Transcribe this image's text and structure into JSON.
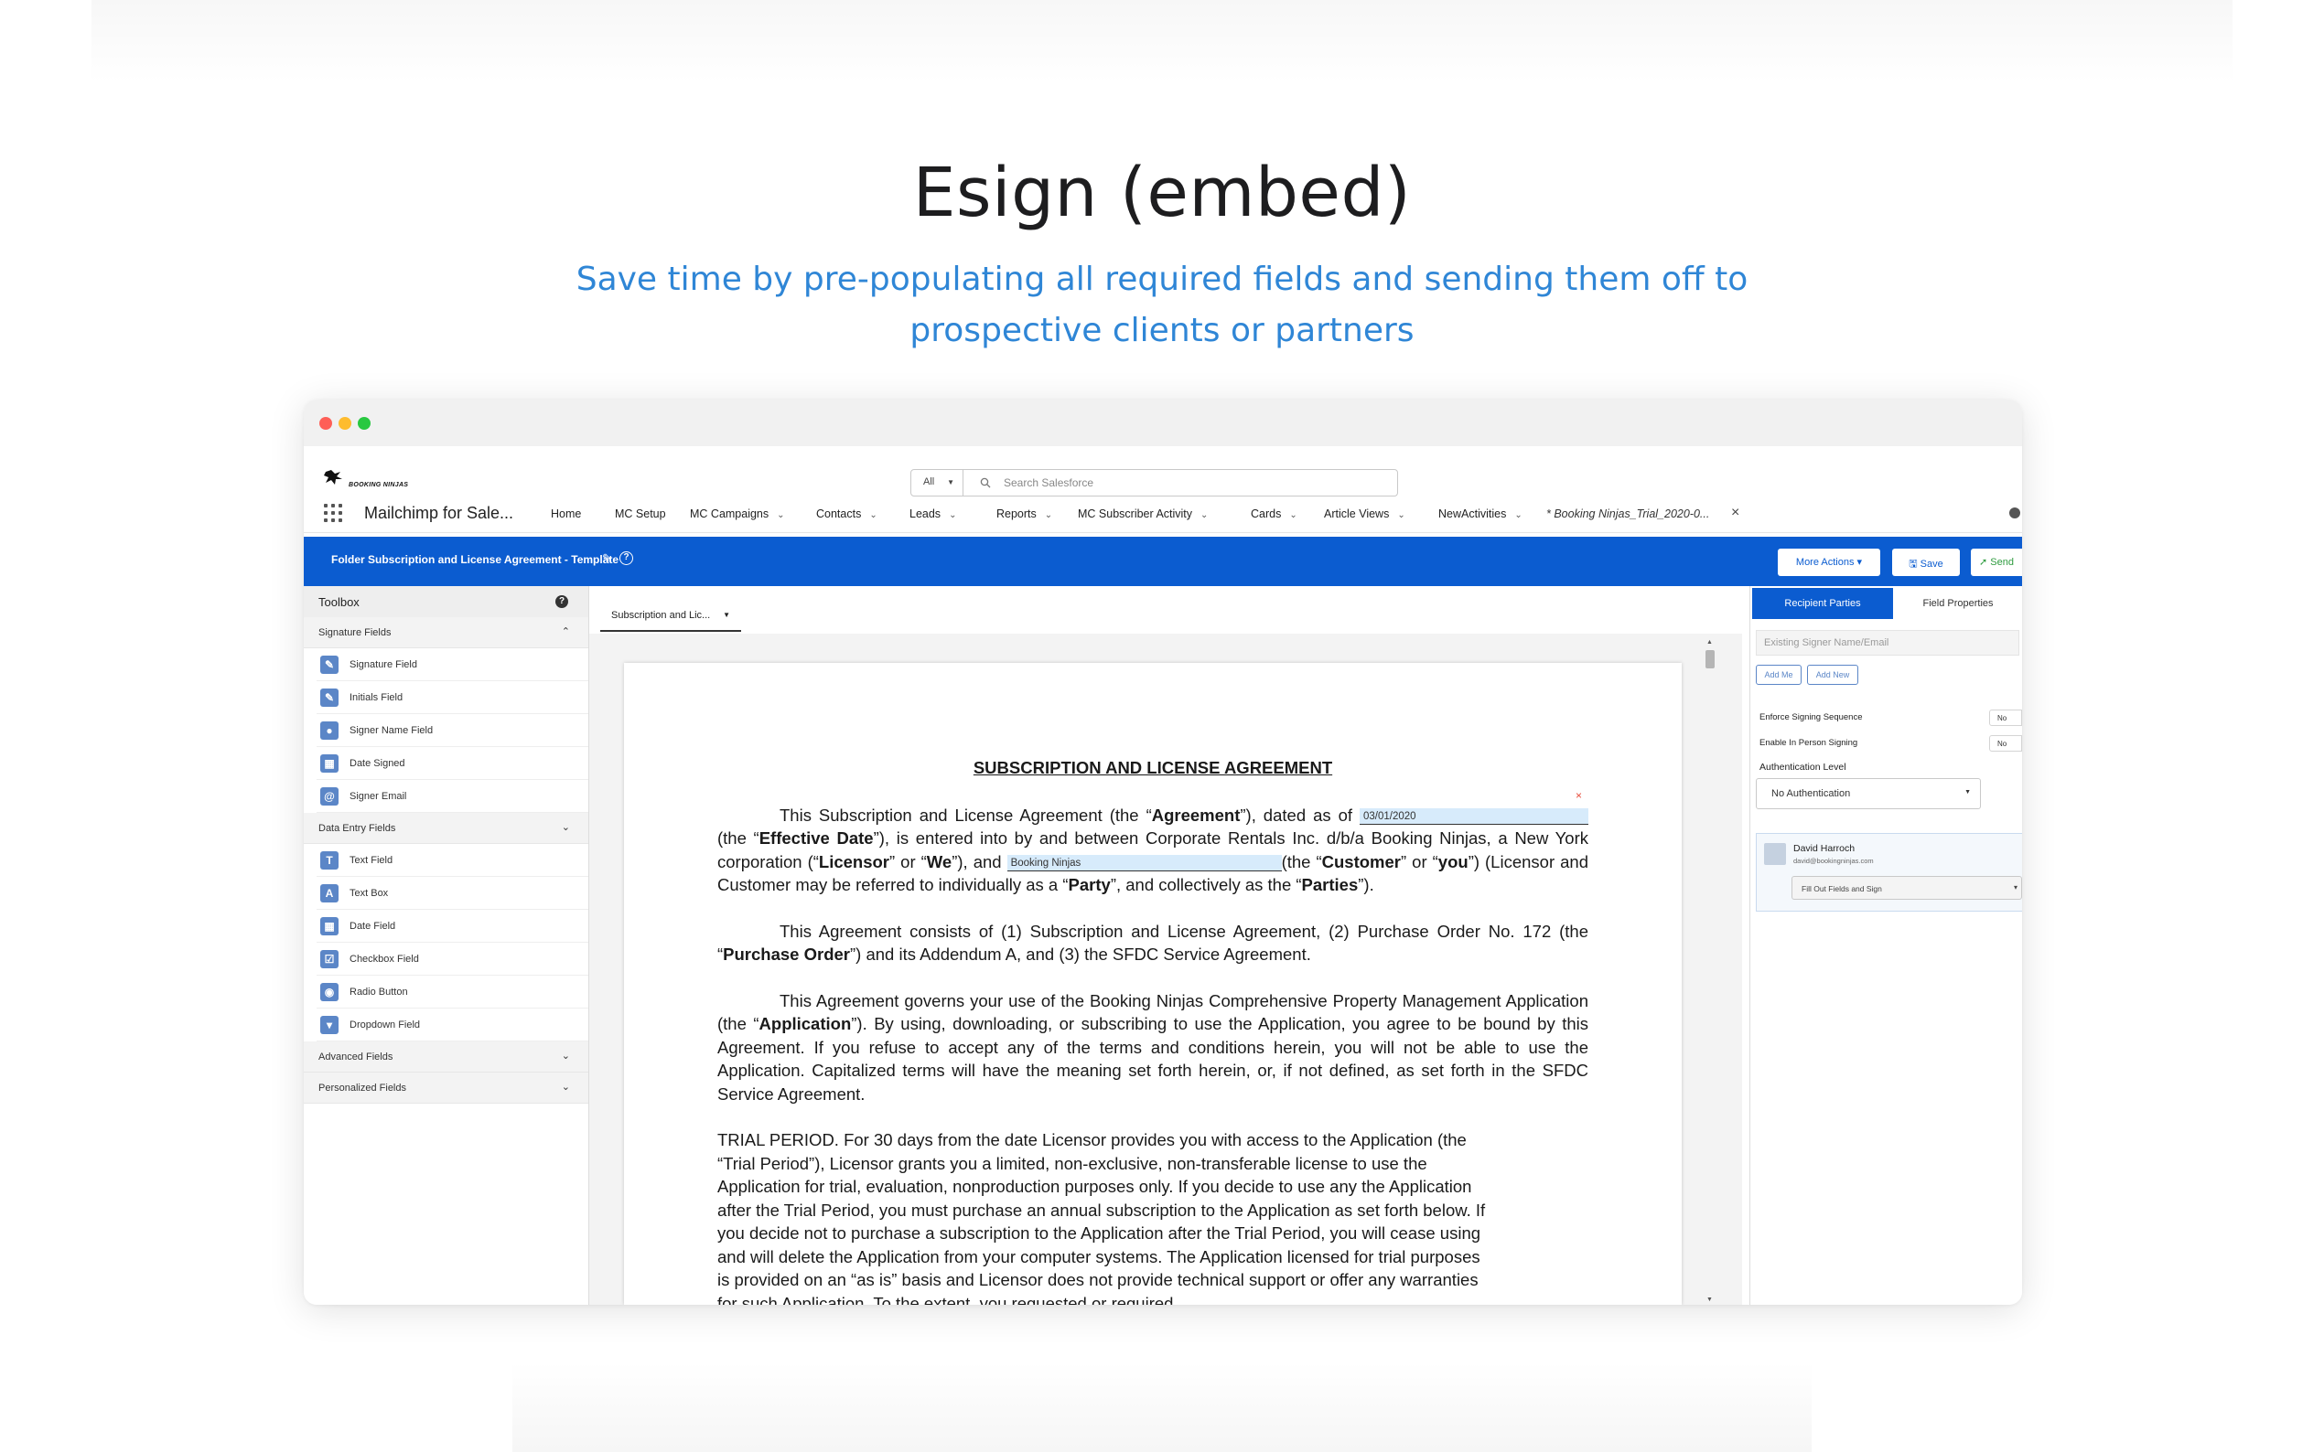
{
  "hero": {
    "title": "Esign (embed)",
    "subtitle": "Save time by pre-populating all required fields and sending them off to prospective clients or partners"
  },
  "header": {
    "logo_text": "BOOKING NINJAS",
    "search_scope": "All",
    "search_placeholder": "Search Salesforce"
  },
  "nav": {
    "app_name": "Mailchimp for Sale...",
    "items": [
      {
        "label": "Home",
        "chevron": false
      },
      {
        "label": "MC Setup",
        "chevron": false
      },
      {
        "label": "MC Campaigns",
        "chevron": true
      },
      {
        "label": "Contacts",
        "chevron": true
      },
      {
        "label": "Leads",
        "chevron": true
      },
      {
        "label": "Reports",
        "chevron": true
      },
      {
        "label": "MC Subscriber Activity",
        "chevron": true
      },
      {
        "label": "Cards",
        "chevron": true
      },
      {
        "label": "Article Views",
        "chevron": true
      },
      {
        "label": "NewActivities",
        "chevron": true
      }
    ],
    "open_tab": "* Booking Ninjas_Trial_2020-0..."
  },
  "bluebar": {
    "title": "Folder Subscription and License Agreement - Template",
    "more_actions": "More Actions ▾",
    "save": "🖫 Save",
    "send": "➚ Send"
  },
  "toolbox": {
    "title": "Toolbox",
    "sections": [
      {
        "label": "Signature Fields",
        "expanded": true,
        "items": [
          {
            "label": "Signature Field",
            "icon": "signature-icon",
            "glyph": "✎"
          },
          {
            "label": "Initials Field",
            "icon": "pen-icon",
            "glyph": "✎"
          },
          {
            "label": "Signer Name Field",
            "icon": "user-icon",
            "glyph": "●"
          },
          {
            "label": "Date Signed",
            "icon": "calendar-icon",
            "glyph": "▦"
          },
          {
            "label": "Signer Email",
            "icon": "at-icon",
            "glyph": "@"
          }
        ]
      },
      {
        "label": "Data Entry Fields",
        "expanded": true,
        "items": [
          {
            "label": "Text Field",
            "icon": "text-field-icon",
            "glyph": "T"
          },
          {
            "label": "Text Box",
            "icon": "text-box-icon",
            "glyph": "A"
          },
          {
            "label": "Date Field",
            "icon": "date-icon",
            "glyph": "▦"
          },
          {
            "label": "Checkbox Field",
            "icon": "checkbox-icon",
            "glyph": "☑"
          },
          {
            "label": "Radio Button",
            "icon": "radio-icon",
            "glyph": "◉"
          },
          {
            "label": "Dropdown Field",
            "icon": "dropdown-icon",
            "glyph": "▾"
          }
        ]
      },
      {
        "label": "Advanced Fields",
        "expanded": false,
        "items": []
      },
      {
        "label": "Personalized Fields",
        "expanded": false,
        "items": []
      }
    ]
  },
  "document": {
    "tab_label": "Subscription and Lic...",
    "title": "SUBSCRIPTION AND LICENSE AGREEMENT",
    "date_field": "03/01/2020",
    "customer_field": "Booking Ninjas",
    "p1_a": "This Subscription and License Agreement (the “",
    "p1_b": "Agreement",
    "p1_c": "”), dated as of",
    "p1_d": "(the “",
    "p1_e": "Effective Date",
    "p1_f": "”), is entered into by and between Corporate Rentals Inc. d/b/a Booking Ninjas, a New York corporation (“",
    "p1_g": "Licensor",
    "p1_h": "” or “",
    "p1_i": "We",
    "p1_j": "”), and",
    "p1_k": "(the “",
    "p1_l": "Customer",
    "p1_m": "” or “",
    "p1_n": "you",
    "p1_o": "”) (Licensor and Customer may be referred to individually as a “",
    "p1_p": "Party",
    "p1_q": "”, and collectively as the “",
    "p1_r": "Parties",
    "p1_s": "”).",
    "p2_a": "This Agreement consists of (1) Subscription and License Agreement, (2) Purchase Order No. 172 (the “",
    "p2_b": "Purchase Order",
    "p2_c": "”) and its Addendum A, and (3) the SFDC Service Agreement.",
    "p3_a": "This Agreement governs your use of the Booking Ninjas Comprehensive Property Management Application (the “",
    "p3_b": "Application",
    "p3_c": "”). By using, downloading, or subscribing to use the Application, you agree to be bound by this Agreement. If you refuse to accept any of the terms and conditions herein, you will not be able to use the Application. Capitalized terms will have the meaning set forth herein, or, if not defined, as set forth in the SFDC Service Agreement.",
    "p4": "TRIAL PERIOD. For 30 days from the date Licensor provides you with access to the Application (the “Trial Period”), Licensor grants you a limited, non-exclusive, non-transferable license to use the Application for trial, evaluation, nonproduction purposes only. If you decide to use any the Application after the Trial Period, you must purchase an annual subscription to the Application as set forth below. If you decide not to purchase a subscription to the Application after the Trial Period, you will cease using and will delete the Application from your computer systems. The Application licensed for trial purposes is provided on an “as is” basis and Licensor does not provide technical support or offer any warranties for such Application. To the extent, you requested or required"
  },
  "right_panel": {
    "tab_recipients": "Recipient Parties",
    "tab_properties": "Field Properties",
    "signer_placeholder": "Existing Signer Name/Email",
    "add_me": "Add Me",
    "add_new": "Add New",
    "enforce_label": "Enforce Signing Sequence",
    "enforce_value": "No",
    "inperson_label": "Enable In Person Signing",
    "inperson_value": "No",
    "auth_label": "Authentication Level",
    "auth_value": "No Authentication",
    "recipient_name": "David Harroch",
    "recipient_email": "david@bookingninjas.com",
    "recipient_action": "Fill Out Fields and Sign"
  }
}
